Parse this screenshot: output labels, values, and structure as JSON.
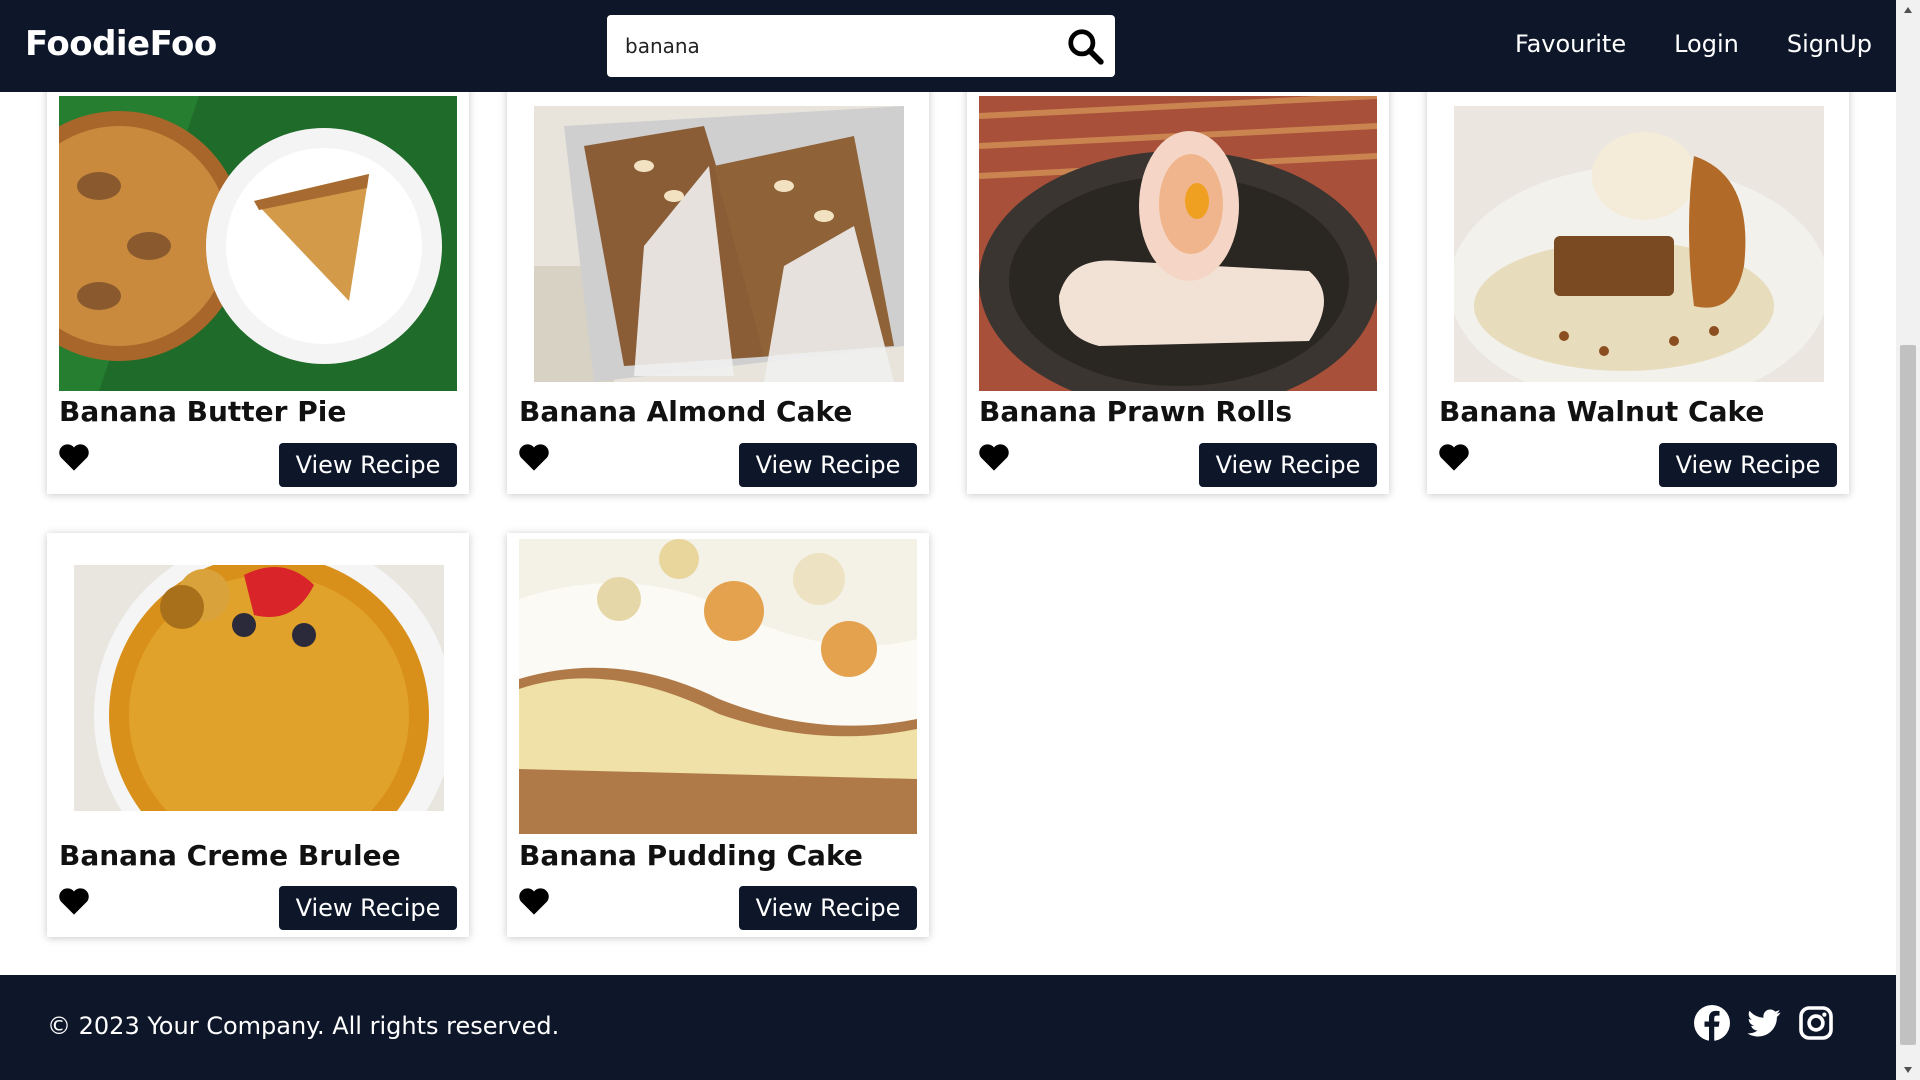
{
  "app": {
    "logo": "FoodieFoo"
  },
  "search": {
    "value": "banana",
    "placeholder": ""
  },
  "nav": {
    "items": [
      "Favourite",
      "Login",
      "SignUp"
    ]
  },
  "recipes": [
    {
      "title": "Banana Butter Pie",
      "button": "View Recipe"
    },
    {
      "title": "Banana Almond Cake",
      "button": "View Recipe"
    },
    {
      "title": "Banana Prawn Rolls",
      "button": "View Recipe"
    },
    {
      "title": "Banana Walnut Cake",
      "button": "View Recipe"
    },
    {
      "title": "Banana Creme Brulee",
      "button": "View Recipe"
    },
    {
      "title": "Banana Pudding Cake",
      "button": "View Recipe"
    }
  ],
  "footer": {
    "copyright": "© 2023 Your Company. All rights reserved.",
    "socials": [
      "facebook-icon",
      "twitter-icon",
      "instagram-icon"
    ]
  },
  "colors": {
    "navy": "#0e1729",
    "white": "#ffffff"
  }
}
